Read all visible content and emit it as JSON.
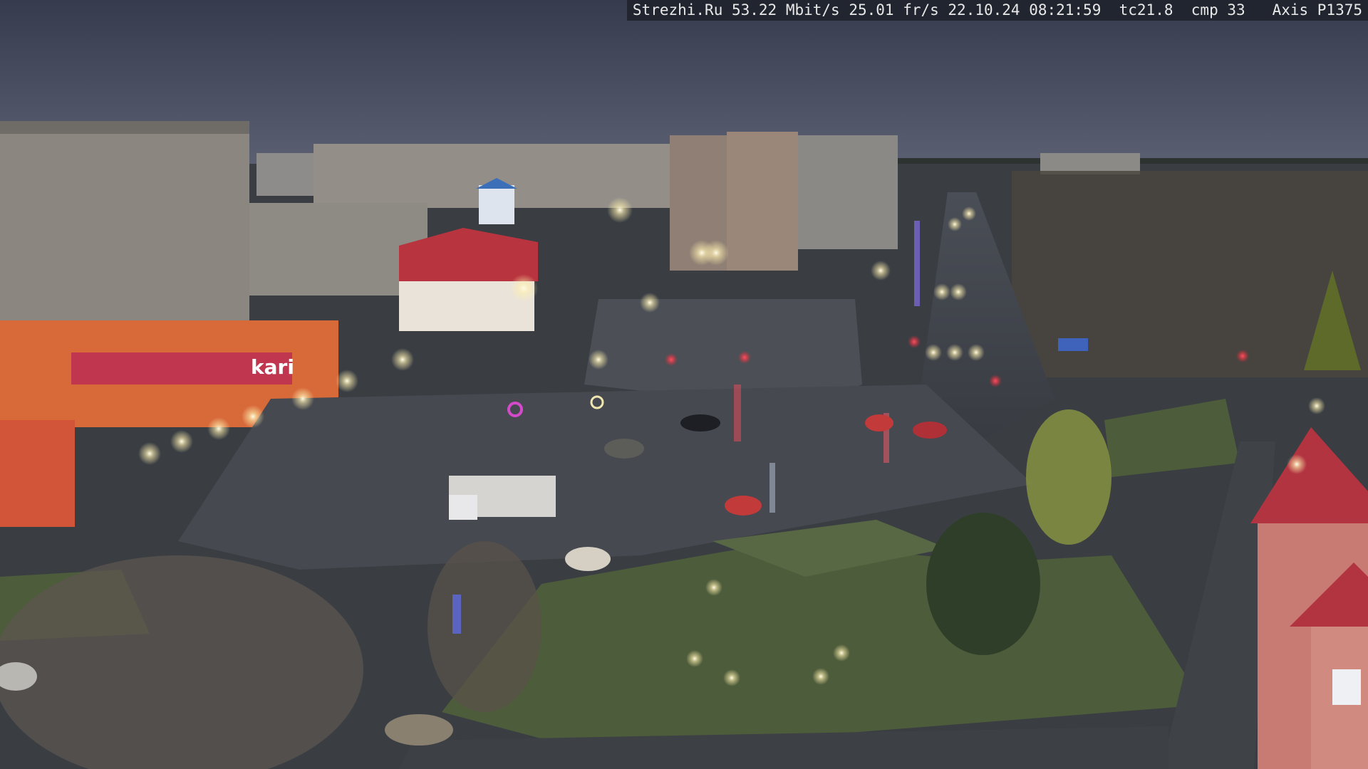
{
  "camera_overlay": {
    "text": "Strezhi.Ru 53.22 Mbit/s 25.01 fr/s 22.10.24 08:21:59  tc21.8  cmp 33   Axis P1375"
  },
  "scene": {
    "storefront_sign": "kari"
  },
  "colors": {
    "sky_top": "#363c4e",
    "sky_bottom": "#5a6072",
    "asphalt": "#3e4248",
    "grass": "#4d5c3a",
    "building_grey": "#8b8680",
    "store_orange": "#d86a3a",
    "store_sign": "#c0364f",
    "red_roof": "#b8343e",
    "street_light": "#fff3c8"
  }
}
